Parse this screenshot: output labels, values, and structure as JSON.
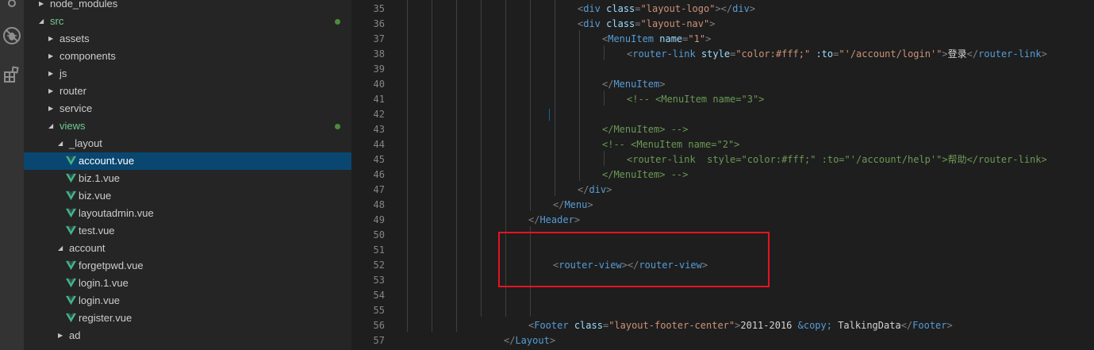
{
  "explorer": {
    "items": [
      {
        "label": "node_modules",
        "type": "folder",
        "expanded": false,
        "level": 1
      },
      {
        "label": "src",
        "type": "folder",
        "expanded": true,
        "level": 1,
        "status": "modified"
      },
      {
        "label": "assets",
        "type": "folder",
        "expanded": false,
        "level": 2
      },
      {
        "label": "components",
        "type": "folder",
        "expanded": false,
        "level": 2
      },
      {
        "label": "js",
        "type": "folder",
        "expanded": false,
        "level": 2
      },
      {
        "label": "router",
        "type": "folder",
        "expanded": false,
        "level": 2
      },
      {
        "label": "service",
        "type": "folder",
        "expanded": false,
        "level": 2
      },
      {
        "label": "views",
        "type": "folder",
        "expanded": true,
        "level": 2,
        "status": "modified"
      },
      {
        "label": "_layout",
        "type": "folder",
        "expanded": true,
        "level": 3
      },
      {
        "label": "account.vue",
        "type": "vue",
        "level": 4,
        "selected": true
      },
      {
        "label": "biz.1.vue",
        "type": "vue",
        "level": 4
      },
      {
        "label": "biz.vue",
        "type": "vue",
        "level": 4
      },
      {
        "label": "layoutadmin.vue",
        "type": "vue",
        "level": 4
      },
      {
        "label": "test.vue",
        "type": "vue",
        "level": 4
      },
      {
        "label": "account",
        "type": "folder",
        "expanded": true,
        "level": 3
      },
      {
        "label": "forgetpwd.vue",
        "type": "vue",
        "level": 4
      },
      {
        "label": "login.1.vue",
        "type": "vue",
        "level": 4
      },
      {
        "label": "login.vue",
        "type": "vue",
        "level": 4
      },
      {
        "label": "register.vue",
        "type": "vue",
        "level": 4
      },
      {
        "label": "ad",
        "type": "folder",
        "expanded": false,
        "level": 3
      }
    ]
  },
  "editor": {
    "lines": [
      {
        "n": "35",
        "indent": 7,
        "tokens": [
          [
            "p",
            "<"
          ],
          [
            "g",
            "div"
          ],
          [
            "a",
            " class"
          ],
          [
            "p",
            "="
          ],
          [
            "s",
            "\"layout-logo\""
          ],
          [
            "p",
            "></"
          ],
          [
            "g",
            "div"
          ],
          [
            "p",
            ">"
          ]
        ]
      },
      {
        "n": "36",
        "indent": 7,
        "tokens": [
          [
            "p",
            "<"
          ],
          [
            "g",
            "div"
          ],
          [
            "a",
            " class"
          ],
          [
            "p",
            "="
          ],
          [
            "s",
            "\"layout-nav\""
          ],
          [
            "p",
            ">"
          ]
        ]
      },
      {
        "n": "37",
        "indent": 8,
        "tokens": [
          [
            "p",
            "<"
          ],
          [
            "g",
            "MenuItem"
          ],
          [
            "a",
            " name"
          ],
          [
            "p",
            "="
          ],
          [
            "s",
            "\"1\""
          ],
          [
            "p",
            ">"
          ]
        ]
      },
      {
        "n": "38",
        "indent": 9,
        "tokens": [
          [
            "p",
            "<"
          ],
          [
            "g",
            "router-link"
          ],
          [
            "a",
            " style"
          ],
          [
            "p",
            "="
          ],
          [
            "s",
            "\"color:#fff;\""
          ],
          [
            "a",
            " :to"
          ],
          [
            "p",
            "="
          ],
          [
            "s",
            "\"'/account/login'\""
          ],
          [
            "p",
            ">"
          ],
          [
            "t",
            "登录"
          ],
          [
            "p",
            "</"
          ],
          [
            "g",
            "router-link"
          ],
          [
            "p",
            ">"
          ]
        ]
      },
      {
        "n": "39",
        "indent": 0,
        "tokens": []
      },
      {
        "n": "40",
        "indent": 8,
        "tokens": [
          [
            "p",
            "</"
          ],
          [
            "g",
            "MenuItem"
          ],
          [
            "p",
            ">"
          ]
        ]
      },
      {
        "n": "41",
        "indent": 9,
        "tokens": [
          [
            "c",
            "<!-- <MenuItem name=\"3\">"
          ]
        ]
      },
      {
        "n": "42",
        "indent": 0,
        "tokens": []
      },
      {
        "n": "43",
        "indent": 8,
        "tokens": [
          [
            "c",
            "</MenuItem> -->"
          ]
        ]
      },
      {
        "n": "44",
        "indent": 8,
        "tokens": [
          [
            "c",
            "<!-- <MenuItem name=\"2\">"
          ]
        ]
      },
      {
        "n": "45",
        "indent": 9,
        "tokens": [
          [
            "c",
            "<router-link  style=\"color:#fff;\" :to=\"'/account/help'\">帮助</router-link>"
          ]
        ]
      },
      {
        "n": "46",
        "indent": 8,
        "tokens": [
          [
            "c",
            "</MenuItem> -->"
          ]
        ]
      },
      {
        "n": "47",
        "indent": 7,
        "tokens": [
          [
            "p",
            "</"
          ],
          [
            "g",
            "div"
          ],
          [
            "p",
            ">"
          ]
        ]
      },
      {
        "n": "48",
        "indent": 6,
        "tokens": [
          [
            "p",
            "</"
          ],
          [
            "g",
            "Menu"
          ],
          [
            "p",
            ">"
          ]
        ]
      },
      {
        "n": "49",
        "indent": 5,
        "tokens": [
          [
            "p",
            "</"
          ],
          [
            "g",
            "Header"
          ],
          [
            "p",
            ">"
          ]
        ]
      },
      {
        "n": "50",
        "indent": 0,
        "tokens": []
      },
      {
        "n": "51",
        "indent": 0,
        "tokens": []
      },
      {
        "n": "52",
        "indent": 6,
        "tokens": [
          [
            "p",
            "<"
          ],
          [
            "g",
            "router-view"
          ],
          [
            "p",
            "></"
          ],
          [
            "g",
            "router-view"
          ],
          [
            "p",
            ">"
          ]
        ]
      },
      {
        "n": "53",
        "indent": 0,
        "tokens": []
      },
      {
        "n": "54",
        "indent": 0,
        "tokens": []
      },
      {
        "n": "55",
        "indent": 0,
        "tokens": []
      },
      {
        "n": "56",
        "indent": 5,
        "tokens": [
          [
            "p",
            "<"
          ],
          [
            "g",
            "Footer"
          ],
          [
            "a",
            " class"
          ],
          [
            "p",
            "="
          ],
          [
            "s",
            "\"layout-footer-center\""
          ],
          [
            "p",
            ">"
          ],
          [
            "t",
            "2011-2016 "
          ],
          [
            "e",
            "&copy;"
          ],
          [
            "t",
            " TalkingData"
          ],
          [
            "p",
            "</"
          ],
          [
            "g",
            "Footer"
          ],
          [
            "p",
            ">"
          ]
        ]
      },
      {
        "n": "57",
        "indent": 4,
        "tokens": [
          [
            "p",
            "</"
          ],
          [
            "g",
            "Layout"
          ],
          [
            "p",
            ">"
          ]
        ]
      }
    ]
  },
  "colors": {
    "tag": "#569cd6",
    "attribute": "#9cdcfe",
    "string": "#ce9178",
    "comment": "#6a9955",
    "text": "#d4d4d4",
    "selection": "#094771",
    "annotation_box": "#e81123",
    "git_modified": "#73c991"
  },
  "activity_bar": {
    "icons": [
      "source-control-icon",
      "debug-icon",
      "extensions-icon"
    ]
  }
}
